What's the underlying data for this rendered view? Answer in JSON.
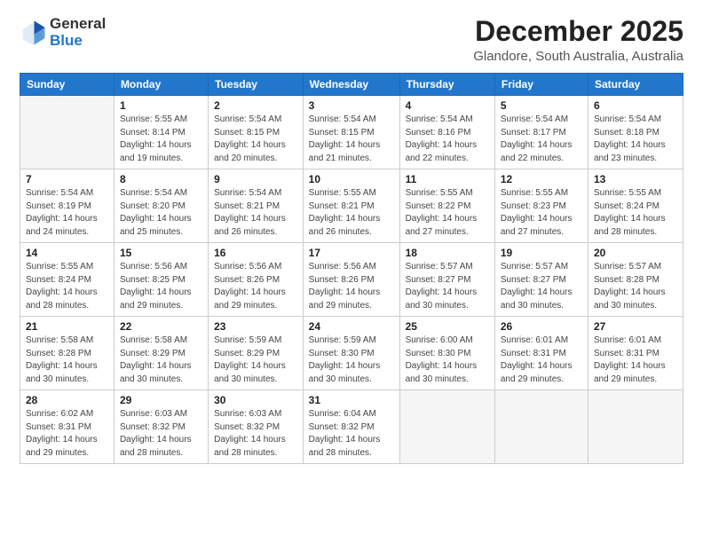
{
  "logo": {
    "general": "General",
    "blue": "Blue"
  },
  "header": {
    "title": "December 2025",
    "subtitle": "Glandore, South Australia, Australia"
  },
  "weekdays": [
    "Sunday",
    "Monday",
    "Tuesday",
    "Wednesday",
    "Thursday",
    "Friday",
    "Saturday"
  ],
  "weeks": [
    [
      {
        "day": "",
        "info": ""
      },
      {
        "day": "1",
        "info": "Sunrise: 5:55 AM\nSunset: 8:14 PM\nDaylight: 14 hours\nand 19 minutes."
      },
      {
        "day": "2",
        "info": "Sunrise: 5:54 AM\nSunset: 8:15 PM\nDaylight: 14 hours\nand 20 minutes."
      },
      {
        "day": "3",
        "info": "Sunrise: 5:54 AM\nSunset: 8:15 PM\nDaylight: 14 hours\nand 21 minutes."
      },
      {
        "day": "4",
        "info": "Sunrise: 5:54 AM\nSunset: 8:16 PM\nDaylight: 14 hours\nand 22 minutes."
      },
      {
        "day": "5",
        "info": "Sunrise: 5:54 AM\nSunset: 8:17 PM\nDaylight: 14 hours\nand 22 minutes."
      },
      {
        "day": "6",
        "info": "Sunrise: 5:54 AM\nSunset: 8:18 PM\nDaylight: 14 hours\nand 23 minutes."
      }
    ],
    [
      {
        "day": "7",
        "info": "Sunrise: 5:54 AM\nSunset: 8:19 PM\nDaylight: 14 hours\nand 24 minutes."
      },
      {
        "day": "8",
        "info": "Sunrise: 5:54 AM\nSunset: 8:20 PM\nDaylight: 14 hours\nand 25 minutes."
      },
      {
        "day": "9",
        "info": "Sunrise: 5:54 AM\nSunset: 8:21 PM\nDaylight: 14 hours\nand 26 minutes."
      },
      {
        "day": "10",
        "info": "Sunrise: 5:55 AM\nSunset: 8:21 PM\nDaylight: 14 hours\nand 26 minutes."
      },
      {
        "day": "11",
        "info": "Sunrise: 5:55 AM\nSunset: 8:22 PM\nDaylight: 14 hours\nand 27 minutes."
      },
      {
        "day": "12",
        "info": "Sunrise: 5:55 AM\nSunset: 8:23 PM\nDaylight: 14 hours\nand 27 minutes."
      },
      {
        "day": "13",
        "info": "Sunrise: 5:55 AM\nSunset: 8:24 PM\nDaylight: 14 hours\nand 28 minutes."
      }
    ],
    [
      {
        "day": "14",
        "info": "Sunrise: 5:55 AM\nSunset: 8:24 PM\nDaylight: 14 hours\nand 28 minutes."
      },
      {
        "day": "15",
        "info": "Sunrise: 5:56 AM\nSunset: 8:25 PM\nDaylight: 14 hours\nand 29 minutes."
      },
      {
        "day": "16",
        "info": "Sunrise: 5:56 AM\nSunset: 8:26 PM\nDaylight: 14 hours\nand 29 minutes."
      },
      {
        "day": "17",
        "info": "Sunrise: 5:56 AM\nSunset: 8:26 PM\nDaylight: 14 hours\nand 29 minutes."
      },
      {
        "day": "18",
        "info": "Sunrise: 5:57 AM\nSunset: 8:27 PM\nDaylight: 14 hours\nand 30 minutes."
      },
      {
        "day": "19",
        "info": "Sunrise: 5:57 AM\nSunset: 8:27 PM\nDaylight: 14 hours\nand 30 minutes."
      },
      {
        "day": "20",
        "info": "Sunrise: 5:57 AM\nSunset: 8:28 PM\nDaylight: 14 hours\nand 30 minutes."
      }
    ],
    [
      {
        "day": "21",
        "info": "Sunrise: 5:58 AM\nSunset: 8:28 PM\nDaylight: 14 hours\nand 30 minutes."
      },
      {
        "day": "22",
        "info": "Sunrise: 5:58 AM\nSunset: 8:29 PM\nDaylight: 14 hours\nand 30 minutes."
      },
      {
        "day": "23",
        "info": "Sunrise: 5:59 AM\nSunset: 8:29 PM\nDaylight: 14 hours\nand 30 minutes."
      },
      {
        "day": "24",
        "info": "Sunrise: 5:59 AM\nSunset: 8:30 PM\nDaylight: 14 hours\nand 30 minutes."
      },
      {
        "day": "25",
        "info": "Sunrise: 6:00 AM\nSunset: 8:30 PM\nDaylight: 14 hours\nand 30 minutes."
      },
      {
        "day": "26",
        "info": "Sunrise: 6:01 AM\nSunset: 8:31 PM\nDaylight: 14 hours\nand 29 minutes."
      },
      {
        "day": "27",
        "info": "Sunrise: 6:01 AM\nSunset: 8:31 PM\nDaylight: 14 hours\nand 29 minutes."
      }
    ],
    [
      {
        "day": "28",
        "info": "Sunrise: 6:02 AM\nSunset: 8:31 PM\nDaylight: 14 hours\nand 29 minutes."
      },
      {
        "day": "29",
        "info": "Sunrise: 6:03 AM\nSunset: 8:32 PM\nDaylight: 14 hours\nand 28 minutes."
      },
      {
        "day": "30",
        "info": "Sunrise: 6:03 AM\nSunset: 8:32 PM\nDaylight: 14 hours\nand 28 minutes."
      },
      {
        "day": "31",
        "info": "Sunrise: 6:04 AM\nSunset: 8:32 PM\nDaylight: 14 hours\nand 28 minutes."
      },
      {
        "day": "",
        "info": ""
      },
      {
        "day": "",
        "info": ""
      },
      {
        "day": "",
        "info": ""
      }
    ]
  ]
}
